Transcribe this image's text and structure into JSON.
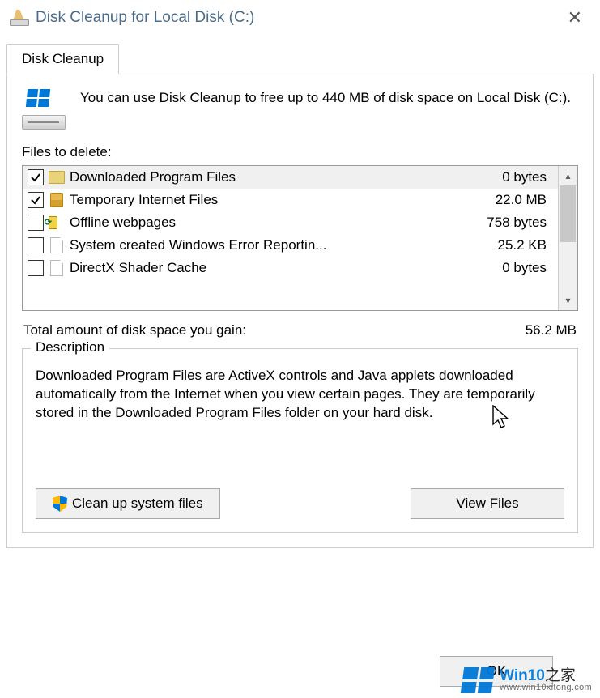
{
  "window": {
    "title": "Disk Cleanup for Local Disk (C:)"
  },
  "tab": {
    "label": "Disk Cleanup"
  },
  "intro": "You can use Disk Cleanup to free up to 440 MB of disk space on Local Disk (C:).",
  "files_label": "Files to delete:",
  "items": [
    {
      "name": "Downloaded Program Files",
      "size": "0 bytes",
      "checked": true,
      "icon": "folder",
      "selected": true
    },
    {
      "name": "Temporary Internet Files",
      "size": "22.0 MB",
      "checked": true,
      "icon": "lock",
      "selected": false
    },
    {
      "name": "Offline webpages",
      "size": "758 bytes",
      "checked": false,
      "icon": "web",
      "selected": false
    },
    {
      "name": "System created Windows Error Reportin...",
      "size": "25.2 KB",
      "checked": false,
      "icon": "file",
      "selected": false
    },
    {
      "name": "DirectX Shader Cache",
      "size": "0 bytes",
      "checked": false,
      "icon": "file",
      "selected": false
    }
  ],
  "total": {
    "label": "Total amount of disk space you gain:",
    "value": "56.2 MB"
  },
  "description": {
    "heading": "Description",
    "body": "Downloaded Program Files are ActiveX controls and Java applets downloaded automatically from the Internet when you view certain pages. They are temporarily stored in the Downloaded Program Files folder on your hard disk."
  },
  "buttons": {
    "cleanup": "Clean up system files",
    "view": "View Files",
    "ok": "OK"
  },
  "watermark": {
    "brand": "Win10",
    "suffix": "之家",
    "url": "www.win10xitong.com"
  }
}
